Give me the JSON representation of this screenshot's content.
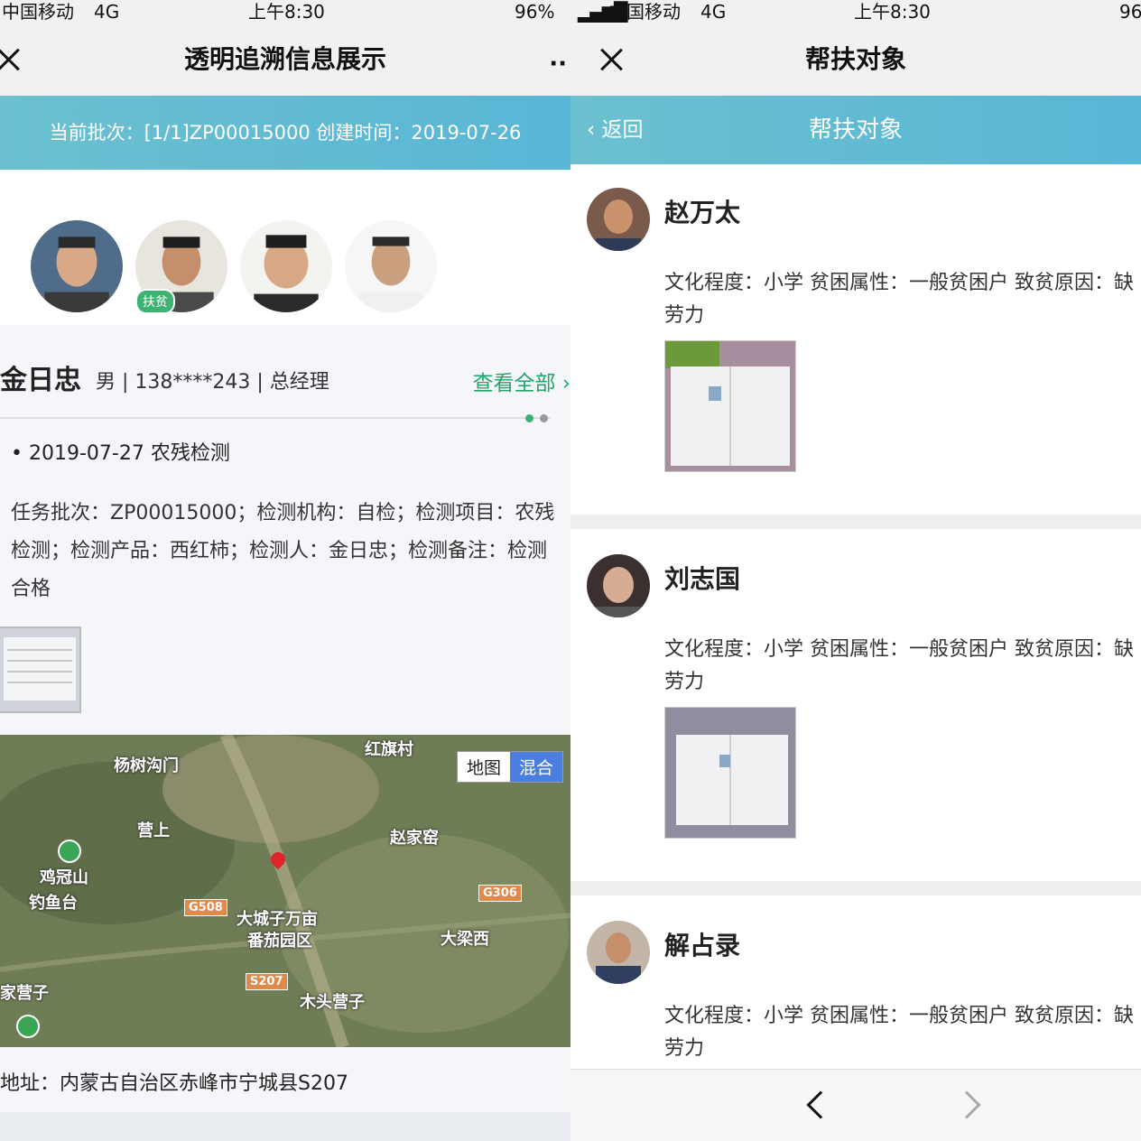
{
  "left": {
    "status": {
      "carrier": "中国移动",
      "network": "4G",
      "time": "上午8:30",
      "battery": "96%"
    },
    "nav": {
      "title": "透明追溯信息展示",
      "more": "··"
    },
    "batch_banner": "当前批次：[1/1]ZP00015000  创建时间：2019-07-26",
    "avatar_badge": "扶贫",
    "person": {
      "name": "金日忠",
      "meta": "男 | 138****243 | 总经理",
      "view_all": "查看全部 ›"
    },
    "record": {
      "date": "• 2019-07-27  农残检测",
      "detail": "任务批次：ZP00015000；检测机构：自检；检测项目：农残检测；检测产品：西红柿；检测人：金日忠；检测备注：检测合格"
    },
    "map": {
      "labels": [
        "杨树沟门",
        "红旗村",
        "营上",
        "鸡冠山",
        "钓鱼台",
        "赵家窑",
        "大城子万亩",
        "番茄园区",
        "大梁西",
        "家营子",
        "木头营子"
      ],
      "roads": [
        "G508",
        "G306",
        "S207"
      ],
      "toggle": {
        "map": "地图",
        "hybrid": "混合"
      }
    },
    "address": "地址：内蒙古自治区赤峰市宁城县S207"
  },
  "right": {
    "status": {
      "carrier": "中国移动",
      "network": "4G",
      "time": "上午8:30",
      "battery": "96"
    },
    "nav": {
      "title": "帮扶对象"
    },
    "banner": {
      "back": "返回",
      "title": "帮扶对象"
    },
    "people": [
      {
        "name": "赵万太",
        "info": "文化程度：小学 贫困属性：一般贫困户 致贫原因：缺劳力"
      },
      {
        "name": "刘志国",
        "info": "文化程度：小学 贫困属性：一般贫困户 致贫原因：缺劳力"
      },
      {
        "name": "解占录",
        "info": "文化程度：小学 贫困属性：一般贫困户 致贫原因：缺劳力"
      }
    ]
  },
  "colors": {
    "banner": "#5fbad3",
    "green": "#24a36b",
    "badge": "#3cb371"
  },
  "icons": [
    "close-icon",
    "more-icon",
    "back-chevron-icon",
    "prev-icon",
    "next-icon",
    "map-pin-icon"
  ]
}
